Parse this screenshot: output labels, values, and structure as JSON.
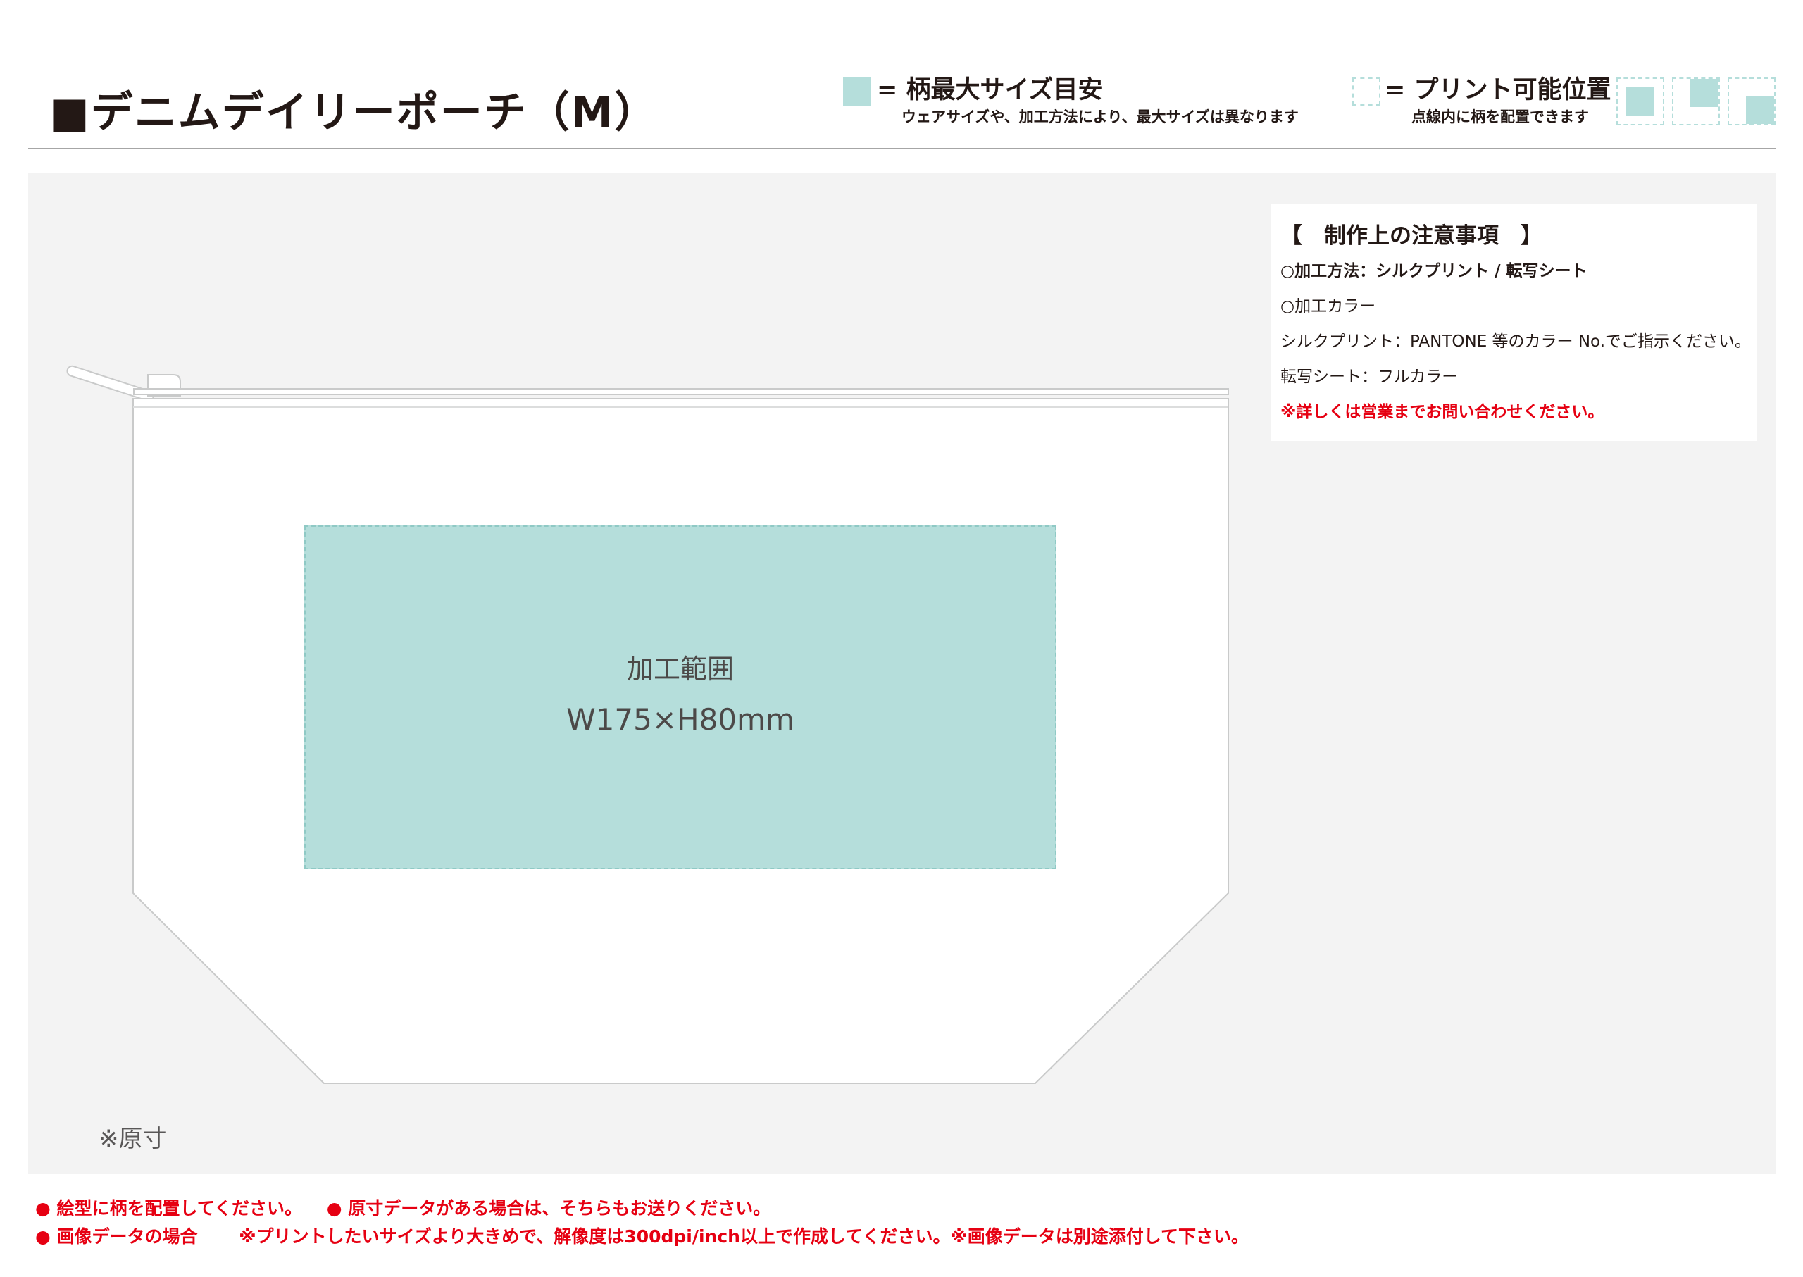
{
  "header": {
    "title": "■デニムデイリーポーチ（M）",
    "legend_max_size": {
      "label": "= 柄最大サイズ目安",
      "sub": "ウェアサイズや、加工方法により、最大サイズは異なります"
    },
    "legend_print_position": {
      "label": "= プリント可能位置",
      "sub": "点線内に柄を配置できます"
    }
  },
  "print_area": {
    "name": "加工範囲",
    "size": "W175×H80mm"
  },
  "scale_note": "※原寸",
  "notes": {
    "title": "【　制作上の注意事項　】",
    "lines": [
      "○加工方法：シルクプリント / 転写シート",
      "○加工カラー",
      "シルクプリント：PANTONE 等のカラー No.でご指示ください。",
      "転写シート：フルカラー",
      "※詳しくは営業までお問い合わせください。"
    ]
  },
  "footer": {
    "line1_a": "● 絵型に柄を配置してください。",
    "line1_b": "● 原寸データがある場合は、そちらもお送りください。",
    "line2_a": "● 画像データの場合",
    "line2_b": "※プリントしたいサイズより大きめで、解像度は300dpi/inch以上で作成してください。※画像データは別途添付して下さい。"
  },
  "colors": {
    "print_area_fill": "#b5dedb",
    "warning_red": "#e60012",
    "work_area_bg": "#f3f3f3"
  }
}
